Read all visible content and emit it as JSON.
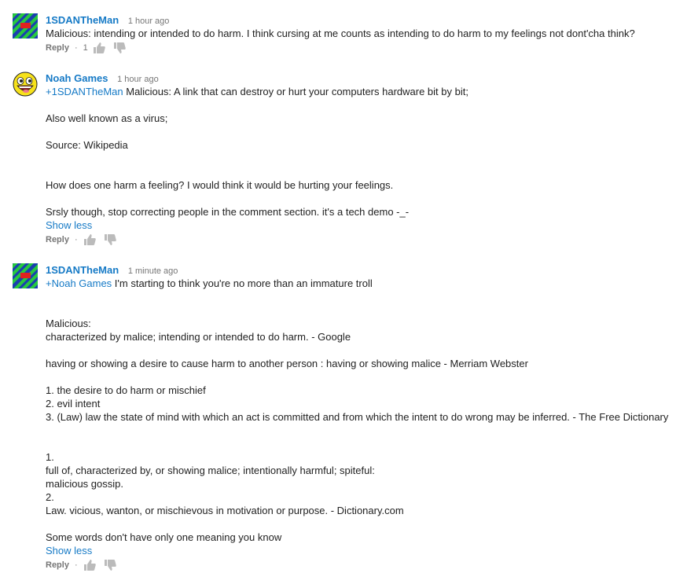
{
  "colors": {
    "link": "#167ac6",
    "meta": "#767676",
    "text": "#222222"
  },
  "comments": [
    {
      "author": "1SDANTheMan",
      "time": "1 hour ago",
      "avatar": "striped-avatar",
      "mention": "",
      "lines": [
        "Malicious: intending or intended to do harm. I think cursing at me counts as intending to do harm to my feelings not dont'cha think?"
      ],
      "reply_label": "Reply",
      "like_count": "1",
      "show_less": ""
    },
    {
      "author": "Noah Games",
      "time": "1 hour ago",
      "avatar": "awesome-face-avatar",
      "mention": "+1SDANTheMan",
      "first_line_rest": " Malicious: A link that can destroy or hurt your computers hardware bit by bit;",
      "lines": [
        "",
        "Also well known as a virus;",
        "",
        "Source: Wikipedia",
        "",
        "",
        "How does one harm a feeling? I would think it would be hurting your feelings.",
        "",
        "Srsly though, stop correcting people in the comment section. it's a tech demo -_-"
      ],
      "show_less": "Show less",
      "reply_label": "Reply",
      "like_count": ""
    },
    {
      "author": "1SDANTheMan",
      "time": "1 minute ago",
      "avatar": "striped-avatar",
      "mention": "+Noah Games",
      "first_line_rest": " I'm starting to think you're no more than an immature troll",
      "lines": [
        "",
        "",
        "Malicious:",
        "characterized by malice; intending or intended to do harm. - Google",
        "",
        "having or showing a desire to cause harm to another person : having or showing malice - Merriam Webster",
        "",
        "1. the desire to do harm or mischief",
        "2. evil intent",
        "3. (Law) law the state of mind with which an act is committed and from which the intent to do wrong may be inferred. - The Free Dictionary",
        "",
        "",
        "1.",
        "full of, characterized by, or showing malice; intentionally harmful; spiteful:",
        "malicious gossip.",
        "2.",
        "Law. vicious, wanton, or mischievous in motivation or purpose. - Dictionary.com",
        "",
        "Some words don't have only one meaning you know"
      ],
      "show_less": "Show less",
      "reply_label": "Reply",
      "like_count": ""
    }
  ]
}
